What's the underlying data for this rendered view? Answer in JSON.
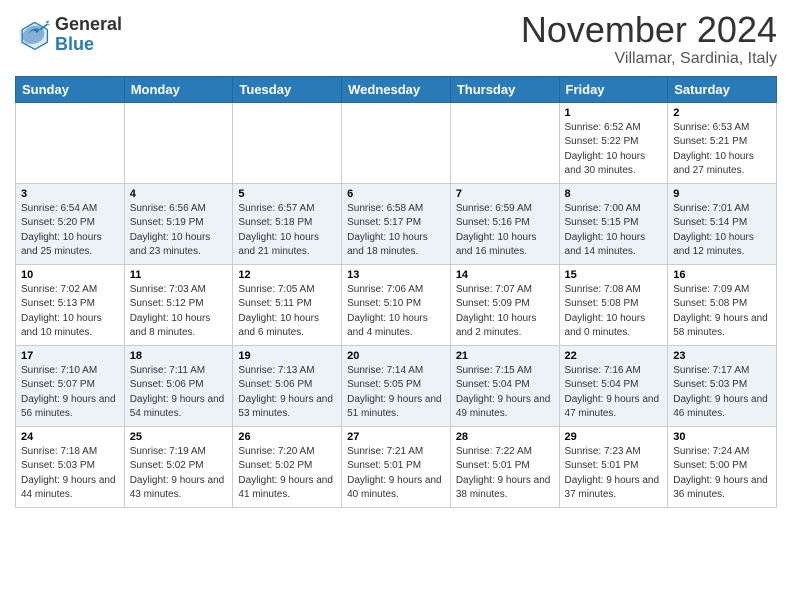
{
  "logo": {
    "general": "General",
    "blue": "Blue"
  },
  "title": "November 2024",
  "location": "Villamar, Sardinia, Italy",
  "weekdays": [
    "Sunday",
    "Monday",
    "Tuesday",
    "Wednesday",
    "Thursday",
    "Friday",
    "Saturday"
  ],
  "weeks": [
    [
      {
        "day": "",
        "info": ""
      },
      {
        "day": "",
        "info": ""
      },
      {
        "day": "",
        "info": ""
      },
      {
        "day": "",
        "info": ""
      },
      {
        "day": "",
        "info": ""
      },
      {
        "day": "1",
        "info": "Sunrise: 6:52 AM\nSunset: 5:22 PM\nDaylight: 10 hours\nand 30 minutes."
      },
      {
        "day": "2",
        "info": "Sunrise: 6:53 AM\nSunset: 5:21 PM\nDaylight: 10 hours\nand 27 minutes."
      }
    ],
    [
      {
        "day": "3",
        "info": "Sunrise: 6:54 AM\nSunset: 5:20 PM\nDaylight: 10 hours\nand 25 minutes."
      },
      {
        "day": "4",
        "info": "Sunrise: 6:56 AM\nSunset: 5:19 PM\nDaylight: 10 hours\nand 23 minutes."
      },
      {
        "day": "5",
        "info": "Sunrise: 6:57 AM\nSunset: 5:18 PM\nDaylight: 10 hours\nand 21 minutes."
      },
      {
        "day": "6",
        "info": "Sunrise: 6:58 AM\nSunset: 5:17 PM\nDaylight: 10 hours\nand 18 minutes."
      },
      {
        "day": "7",
        "info": "Sunrise: 6:59 AM\nSunset: 5:16 PM\nDaylight: 10 hours\nand 16 minutes."
      },
      {
        "day": "8",
        "info": "Sunrise: 7:00 AM\nSunset: 5:15 PM\nDaylight: 10 hours\nand 14 minutes."
      },
      {
        "day": "9",
        "info": "Sunrise: 7:01 AM\nSunset: 5:14 PM\nDaylight: 10 hours\nand 12 minutes."
      }
    ],
    [
      {
        "day": "10",
        "info": "Sunrise: 7:02 AM\nSunset: 5:13 PM\nDaylight: 10 hours\nand 10 minutes."
      },
      {
        "day": "11",
        "info": "Sunrise: 7:03 AM\nSunset: 5:12 PM\nDaylight: 10 hours\nand 8 minutes."
      },
      {
        "day": "12",
        "info": "Sunrise: 7:05 AM\nSunset: 5:11 PM\nDaylight: 10 hours\nand 6 minutes."
      },
      {
        "day": "13",
        "info": "Sunrise: 7:06 AM\nSunset: 5:10 PM\nDaylight: 10 hours\nand 4 minutes."
      },
      {
        "day": "14",
        "info": "Sunrise: 7:07 AM\nSunset: 5:09 PM\nDaylight: 10 hours\nand 2 minutes."
      },
      {
        "day": "15",
        "info": "Sunrise: 7:08 AM\nSunset: 5:08 PM\nDaylight: 10 hours\nand 0 minutes."
      },
      {
        "day": "16",
        "info": "Sunrise: 7:09 AM\nSunset: 5:08 PM\nDaylight: 9 hours\nand 58 minutes."
      }
    ],
    [
      {
        "day": "17",
        "info": "Sunrise: 7:10 AM\nSunset: 5:07 PM\nDaylight: 9 hours\nand 56 minutes."
      },
      {
        "day": "18",
        "info": "Sunrise: 7:11 AM\nSunset: 5:06 PM\nDaylight: 9 hours\nand 54 minutes."
      },
      {
        "day": "19",
        "info": "Sunrise: 7:13 AM\nSunset: 5:06 PM\nDaylight: 9 hours\nand 53 minutes."
      },
      {
        "day": "20",
        "info": "Sunrise: 7:14 AM\nSunset: 5:05 PM\nDaylight: 9 hours\nand 51 minutes."
      },
      {
        "day": "21",
        "info": "Sunrise: 7:15 AM\nSunset: 5:04 PM\nDaylight: 9 hours\nand 49 minutes."
      },
      {
        "day": "22",
        "info": "Sunrise: 7:16 AM\nSunset: 5:04 PM\nDaylight: 9 hours\nand 47 minutes."
      },
      {
        "day": "23",
        "info": "Sunrise: 7:17 AM\nSunset: 5:03 PM\nDaylight: 9 hours\nand 46 minutes."
      }
    ],
    [
      {
        "day": "24",
        "info": "Sunrise: 7:18 AM\nSunset: 5:03 PM\nDaylight: 9 hours\nand 44 minutes."
      },
      {
        "day": "25",
        "info": "Sunrise: 7:19 AM\nSunset: 5:02 PM\nDaylight: 9 hours\nand 43 minutes."
      },
      {
        "day": "26",
        "info": "Sunrise: 7:20 AM\nSunset: 5:02 PM\nDaylight: 9 hours\nand 41 minutes."
      },
      {
        "day": "27",
        "info": "Sunrise: 7:21 AM\nSunset: 5:01 PM\nDaylight: 9 hours\nand 40 minutes."
      },
      {
        "day": "28",
        "info": "Sunrise: 7:22 AM\nSunset: 5:01 PM\nDaylight: 9 hours\nand 38 minutes."
      },
      {
        "day": "29",
        "info": "Sunrise: 7:23 AM\nSunset: 5:01 PM\nDaylight: 9 hours\nand 37 minutes."
      },
      {
        "day": "30",
        "info": "Sunrise: 7:24 AM\nSunset: 5:00 PM\nDaylight: 9 hours\nand 36 minutes."
      }
    ]
  ]
}
